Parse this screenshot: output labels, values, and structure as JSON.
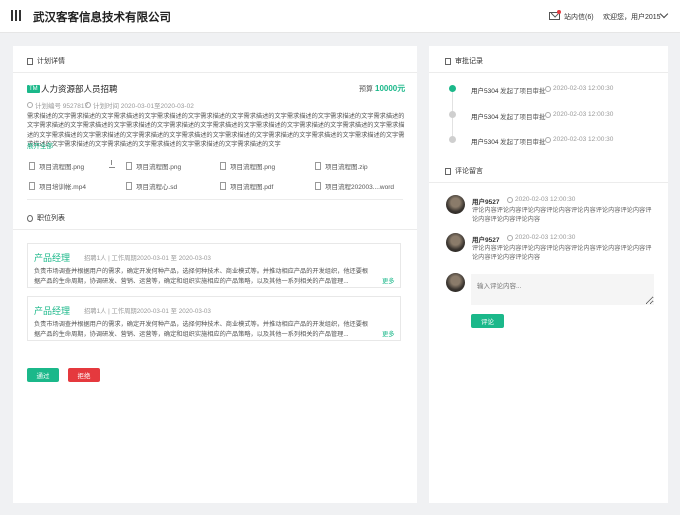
{
  "header": {
    "company": "武汉客客信息技术有限公司",
    "messages_label": "站内信(6)",
    "welcome": "欢迎您，用户2015"
  },
  "plan": {
    "section_title": "计划详情",
    "tag": "TM",
    "title": "人力资源部人员招聘",
    "budget_label": "预算",
    "budget_value": "10000元",
    "plan_no": "计划编号 9527817",
    "plan_time": "计划时间 2020-03-01至2020-03-02",
    "description": "需求描述的文字需求描述的文字需求描述的文字需求描述的文字需求描述的文字需求描述的文字需求描述的文字需求描述的文字需求描述的文字需求描述的文字需求描述的文字需求描述的文字需求描述的文字需求描述的文字需求描述的文字需求描述的文字需求描述的文字需求描述的文字需求描述的文字需求描述的文字需求描述的文字需求描述的文字需求描述的文字需求描述的文字需求描述的文字需求描述的文字需求描述的文字需求描述的文字需求描述的文字需求描述的文字需求描述的文字需求描述的文字",
    "expand": "展开全部",
    "files": [
      "项目流程图.png",
      "项目流程图.png",
      "项目流程图.png",
      "项目流程图.zip",
      "项目培训帐.mp4",
      "项目流程心.sd",
      "项目流程图.pdf",
      "项目流程202003....word"
    ]
  },
  "jobs": {
    "section_title": "职位列表",
    "items": [
      {
        "title": "产品经理",
        "meta": "招聘1人 | 工作周期2020-03-01 至 2020-03-03",
        "desc": "负责市场调查并根据用户的需求，确定开发何种产品，选择何种技术、商业模式等。并推动相应产品的开发组织，他还要根据产品的生命周期，协调研发、营销、运营等，确定和组织实施相应的产品策略，以及其他一系列相关的产品管理...",
        "more": "更多"
      },
      {
        "title": "产品经理",
        "meta": "招聘1人 | 工作周期2020-03-01 至 2020-03-03",
        "desc": "负责市场调查并根据用户的需求，确定开发何种产品，选择何种技术、商业模式等。并推动相应产品的开发组织，他还要根据产品的生命周期，协调研发、营销、运营等，确定和组织实施相应的产品策略，以及其他一系列相关的产品管理...",
        "more": "更多"
      }
    ]
  },
  "actions": {
    "pass": "通过",
    "reject": "拒绝"
  },
  "audit": {
    "section_title": "审批记录",
    "items": [
      {
        "user": "用户5304",
        "action": "发起了项目审批",
        "time": "2020-02-03   12:00:30",
        "color": "#1bb88a"
      },
      {
        "user": "用户5304",
        "action": "发起了项目审批",
        "time": "2020-02-03   12:00:30",
        "color": "#cfcfcf"
      },
      {
        "user": "用户5304",
        "action": "发起了项目审批",
        "time": "2020-02-03   12:00:30",
        "color": "#cfcfcf"
      }
    ]
  },
  "comments": {
    "section_title": "评论留言",
    "items": [
      {
        "user": "用户9527",
        "time": "2020-02-03   12:00:30",
        "text": "评论内容评论内容评论内容评论内容评论内容评论内容评论内容评论内容评论内容评论内容"
      },
      {
        "user": "用户9527",
        "time": "2020-02-03   12:00:30",
        "text": "评论内容评论内容评论内容评论内容评论内容评论内容评论内容评论内容评论内容评论内容"
      }
    ],
    "input_placeholder": "输入评论内容...",
    "submit": "评论"
  },
  "colors": {
    "accent": "#1bb88a",
    "danger": "#e5393e"
  }
}
